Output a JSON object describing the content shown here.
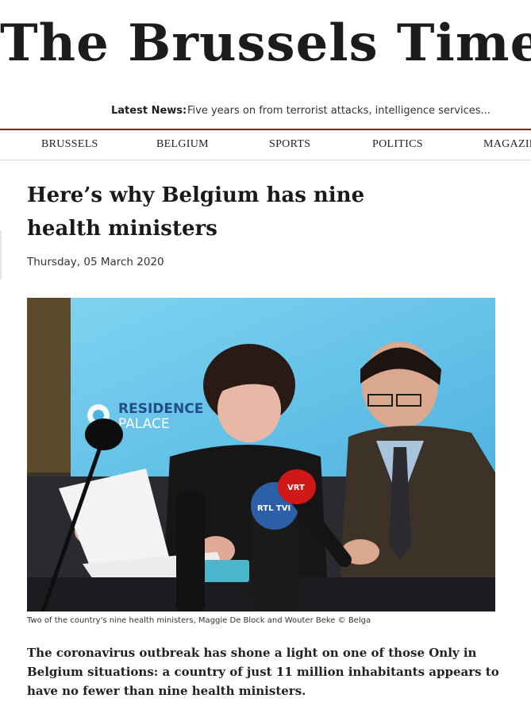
{
  "site": {
    "name": "The Brussels Times"
  },
  "ticker": {
    "label": "Latest News:",
    "headline": "Five years on from terrorist attacks, intelligence services..."
  },
  "nav": {
    "items": [
      {
        "label": "BRUSSELS"
      },
      {
        "label": "BELGIUM"
      },
      {
        "label": "SPORTS"
      },
      {
        "label": "POLITICS"
      },
      {
        "label": "MAGAZINE"
      }
    ]
  },
  "article": {
    "title": "Here’s why Belgium has nine health ministers",
    "date": "Thursday, 05 March 2020",
    "image": {
      "banner_text_1": "RESIDENCE",
      "banner_text_2": "PALACE",
      "mic_label_1": "RTL TVI",
      "mic_label_2": "VRT"
    },
    "caption": "Two of the country's nine health ministers, Maggie De Block and Wouter Beke © Belga",
    "lead": "The coronavirus outbreak has shone a light on one of those Only in Belgium situations: a country of just 11 million inhabitants appears to have no fewer than nine health ministers."
  },
  "colors": {
    "accent": "#8b1d1d",
    "text": "#1d1d1d"
  }
}
